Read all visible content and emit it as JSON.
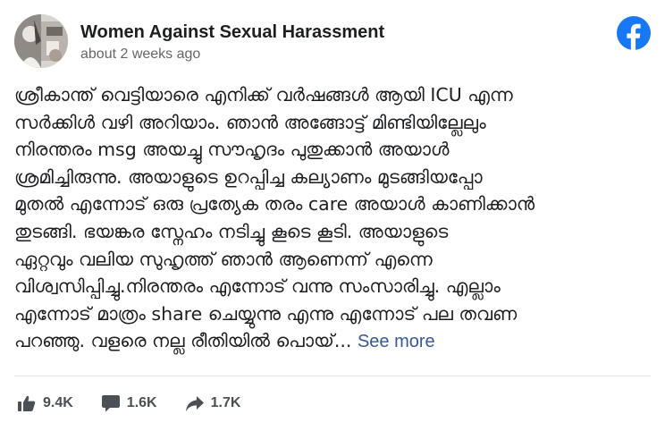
{
  "post": {
    "page_name": "Women Against Sexual Harassment",
    "timestamp": "about 2 weeks ago",
    "body_lines": [
      "ശ്രീകാന്ത് വെട്ടിയാരെ എനിക്ക് വർഷങ്ങൾ ആയി ICU എന്ന",
      "സർക്കിൾ വഴി അറിയാം. ഞാൻ അങ്ങോട്ട് മിണ്ടിയില്ലേലും",
      "നിരന്തരം msg അയച്ചു സൗഹൃദം പുതുക്കാൻ അയാൾ",
      "ശ്രമിച്ചിരുന്നു. അയാളുടെ ഉറപ്പിച്ച കല്യാണം മുടങ്ങിയപ്പോ",
      "മുതൽ എന്നോട് ഒരു പ്രത്യേക തരം care അയാൾ കാണിക്കാൻ",
      "തുടങ്ങി. ഭയങ്കര സ്നേഹം നടിച്ചു കൂടെ കൂടി. അയാളുടെ",
      "ഏറ്റവും വലിയ സുഹൃത്ത് ഞാൻ ആണെന്ന് എന്നെ",
      "വിശ്വസിപ്പിച്ചു.നിരന്തരം എന്നോട് വന്നു സംസാരിച്ചു. എല്ലാം",
      "എന്നോട് മാത്രം share ചെയ്യുന്നു എന്നു എന്നോട് പല തവണ",
      "പറഞ്ഞു. വളരെ നല്ല രീതിയിൽ പൊയ്..."
    ],
    "see_more": "See more"
  },
  "stats": {
    "likes": "9.4K",
    "comments": "1.6K",
    "shares": "1.7K"
  },
  "icons": {
    "brand_logo": "facebook-icon",
    "likes": "thumbs-up-icon",
    "comments": "comment-icon",
    "shares": "share-arrow-icon"
  },
  "colors": {
    "facebook_blue": "#1877f2",
    "link_blue": "#385898",
    "text_primary": "#1c1e21",
    "text_secondary": "#65676b",
    "footer_text": "#4b4f56"
  }
}
